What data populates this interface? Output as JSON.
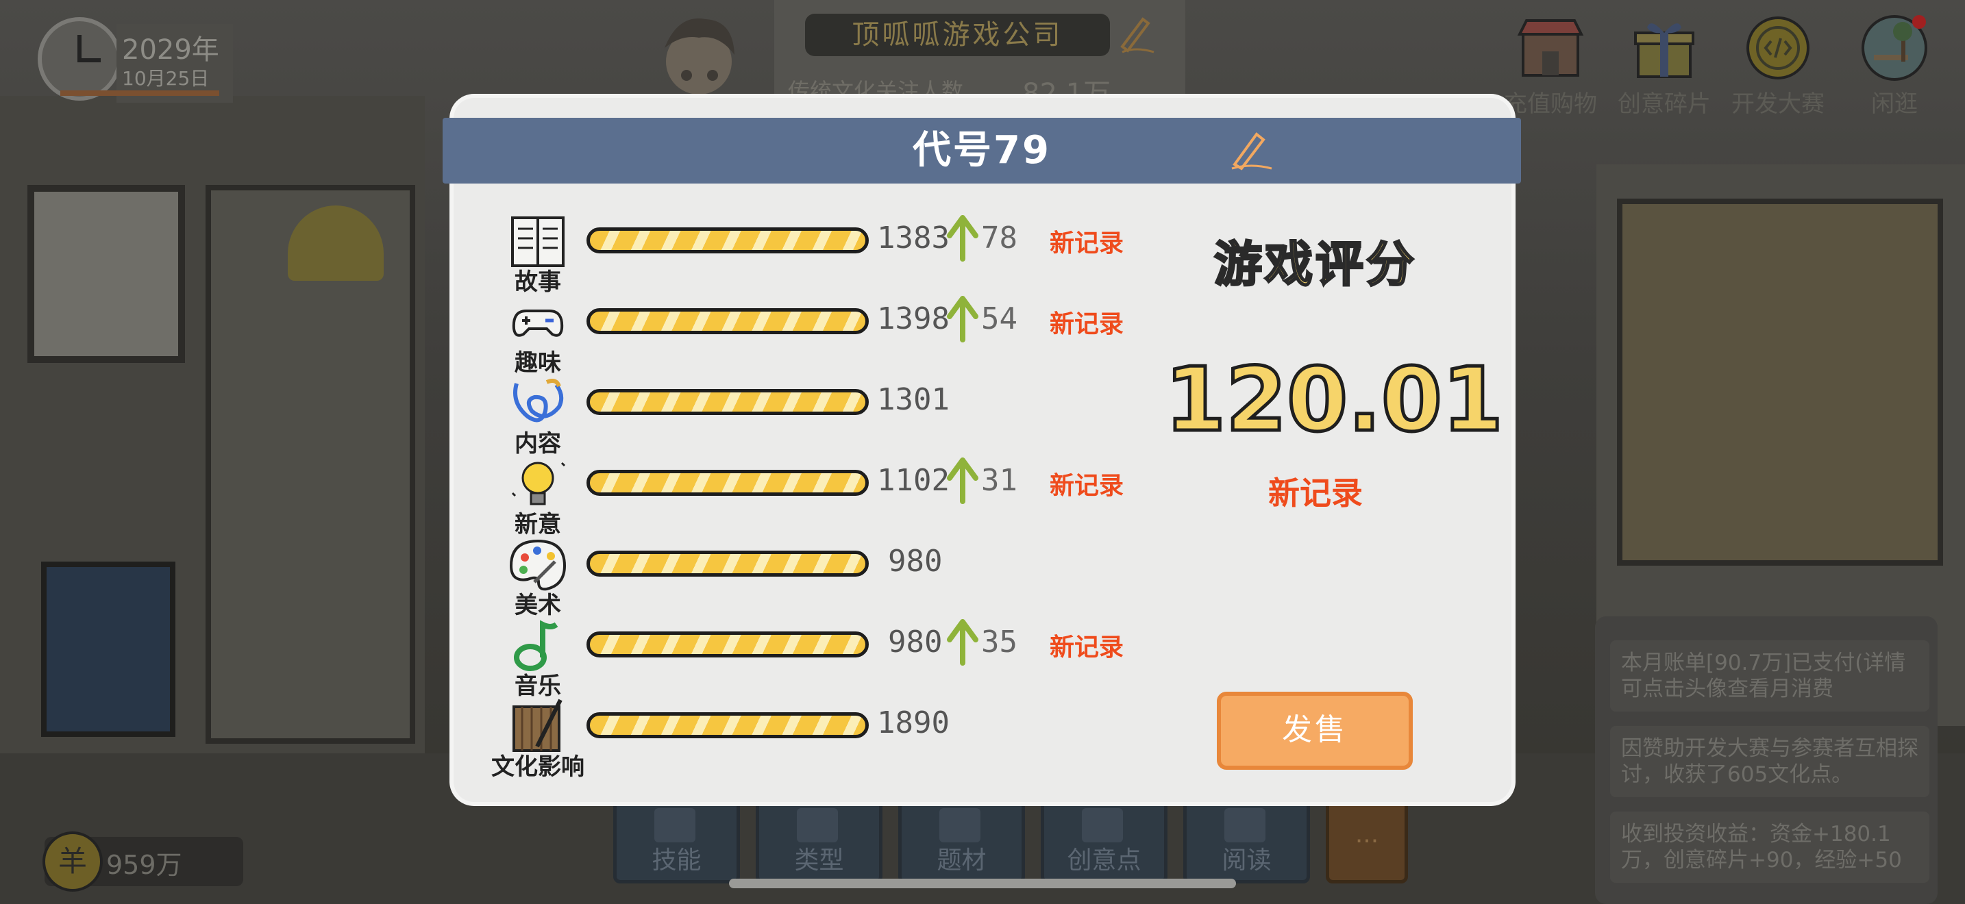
{
  "hud": {
    "year": "2029年",
    "date": "10月25日",
    "company_name": "顶呱呱游戏公司",
    "fans_label": "传统文化关注人数",
    "fans_value": "82.1万",
    "money": "959万",
    "money_symbol": "羊",
    "top_buttons": [
      {
        "label": "充值购物",
        "icon": "shop-icon"
      },
      {
        "label": "创意碎片",
        "icon": "gift-box-icon"
      },
      {
        "label": "开发大赛",
        "icon": "code-medal-icon"
      },
      {
        "label": "闲逛",
        "icon": "park-bench-icon"
      }
    ],
    "bottom_tabs": [
      "技能",
      "类型",
      "题材",
      "创意点",
      "阅读",
      "···"
    ],
    "messages": [
      "本月账单[90.7万]已支付(详情可点击头像查看月消费",
      "因赞助开发大赛与参赛者互相探讨，收获了605文化点。",
      "收到投资收益：资金+180.1万，创意碎片+90，经验+50"
    ]
  },
  "dialog": {
    "title": "代号79",
    "stats": [
      {
        "label": "故事",
        "icon": "book-icon",
        "value": "1383",
        "increase": "78",
        "record": "新记录",
        "fill": 1.0
      },
      {
        "label": "趣味",
        "icon": "gamepad-icon",
        "value": "1398",
        "increase": "54",
        "record": "新记录",
        "fill": 1.0
      },
      {
        "label": "内容",
        "icon": "swirl-icon",
        "value": "1301",
        "increase": "",
        "record": "",
        "fill": 1.0
      },
      {
        "label": "新意",
        "icon": "lightbulb-icon",
        "value": "1102",
        "increase": "31",
        "record": "新记录",
        "fill": 1.0
      },
      {
        "label": "美术",
        "icon": "palette-icon",
        "value": "980",
        "increase": "",
        "record": "",
        "fill": 1.0
      },
      {
        "label": "音乐",
        "icon": "music-note-icon",
        "value": "980",
        "increase": "35",
        "record": "新记录",
        "fill": 1.0
      },
      {
        "label": "文化影响",
        "icon": "scroll-brush-icon",
        "value": "1890",
        "increase": "",
        "record": "",
        "fill": 1.0
      }
    ],
    "score_title": "游戏评分",
    "score_value": "120.01",
    "score_record": "新记录",
    "sell_button": "发售"
  },
  "colors": {
    "header": "#5b6f8f",
    "record": "#ef4b1c",
    "score": "#f6d46a",
    "bar_stripe": "#f6c640",
    "arrow": "#8fb33a",
    "sell_button": "#f6aa63"
  }
}
